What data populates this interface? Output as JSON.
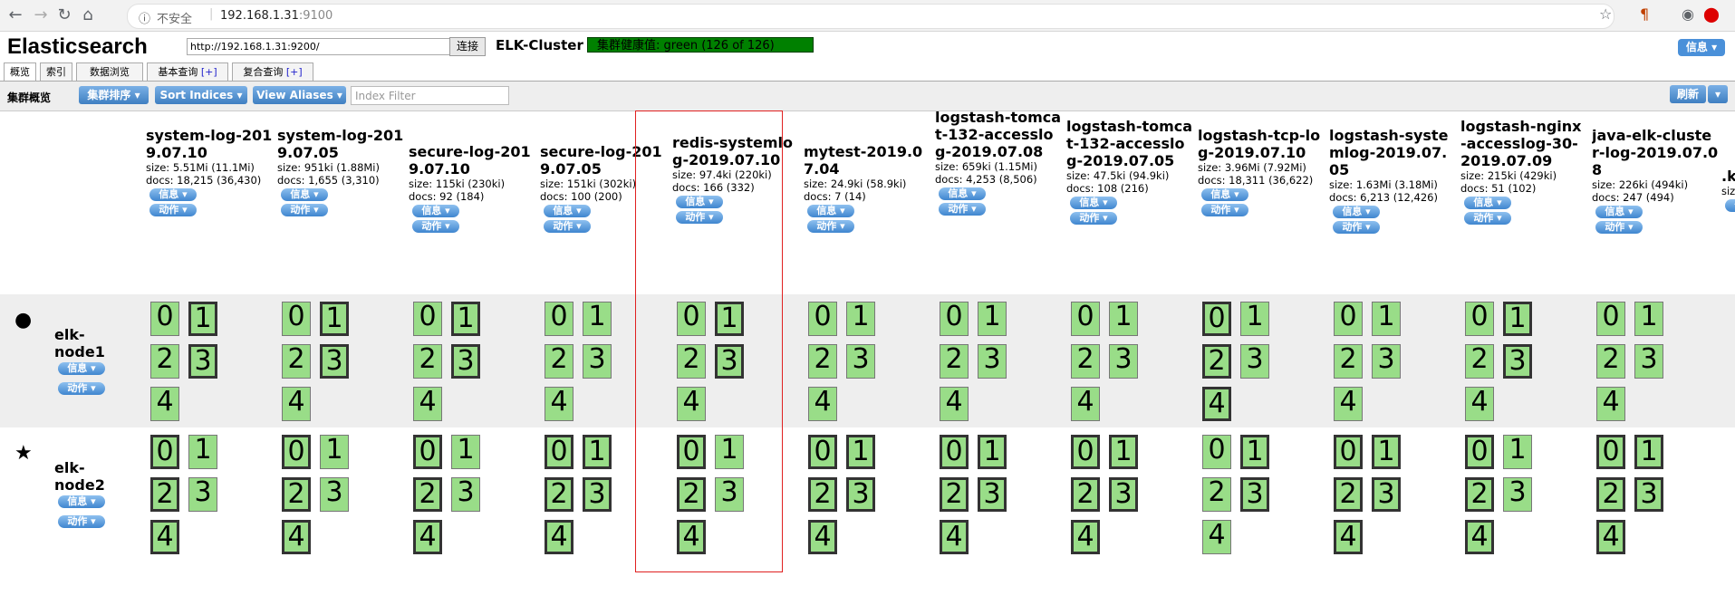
{
  "browser": {
    "security_label": "不安全",
    "url_host": "192.168.1.31",
    "url_port": ":9100"
  },
  "header": {
    "brand": "Elasticsearch",
    "connect_url": "http://192.168.1.31:9200/",
    "connect_button": "连接",
    "cluster_name": "ELK-Cluster",
    "health_text": "集群健康值: green (126 of 126)",
    "health_color": "#008000",
    "info_button": "信息 ▾"
  },
  "tabs": [
    {
      "label": "概览",
      "plus": ""
    },
    {
      "label": "索引",
      "plus": ""
    },
    {
      "label": "数据浏览",
      "plus": ""
    },
    {
      "label": "基本查询",
      "plus": "[+]"
    },
    {
      "label": "复合查询",
      "plus": "[+]"
    }
  ],
  "toolbar": {
    "title": "集群概览",
    "sort_cluster": "集群排序 ▾",
    "sort_indices": "Sort Indices ▾",
    "view_aliases": "View Aliases ▾",
    "filter_placeholder": "Index Filter",
    "refresh": "刷新",
    "refresh_arrow": "▾"
  },
  "pill_info": "信息 ▾",
  "pill_action": "动作 ▾",
  "indices": [
    {
      "name": "system-log-2019.07.10",
      "size": "size: 5.51Mi (11.1Mi)",
      "docs": "docs: 18,215 (36,430)"
    },
    {
      "name": "system-log-2019.07.05",
      "size": "size: 951ki (1.88Mi)",
      "docs": "docs: 1,655 (3,310)"
    },
    {
      "name": "secure-log-2019.07.10",
      "size": "size: 115ki (230ki)",
      "docs": "docs: 92 (184)"
    },
    {
      "name": "secure-log-2019.07.05",
      "size": "size: 151ki (302ki)",
      "docs": "docs: 100 (200)"
    },
    {
      "name": "redis-systemlog-2019.07.10",
      "size": "size: 97.4ki (220ki)",
      "docs": "docs: 166 (332)"
    },
    {
      "name": "mytest-2019.07.04",
      "size": "size: 24.9ki (58.9ki)",
      "docs": "docs: 7 (14)"
    },
    {
      "name": "logstash-tomcat-132-accesslog-2019.07.08",
      "size": "size: 659ki (1.15Mi)",
      "docs": "docs: 4,253 (8,506)"
    },
    {
      "name": "logstash-tomcat-132-accesslog-2019.07.05",
      "size": "size: 47.5ki (94.9ki)",
      "docs": "docs: 108 (216)"
    },
    {
      "name": "logstash-tcp-log-2019.07.10",
      "size": "size: 3.96Mi (7.92Mi)",
      "docs": "docs: 18,311 (36,622)"
    },
    {
      "name": "logstash-systemlog-2019.07.05",
      "size": "size: 1.63Mi (3.18Mi)",
      "docs": "docs: 6,213 (12,426)"
    },
    {
      "name": "logstash-nginx-accesslog-30-2019.07.09",
      "size": "size: 215ki (429ki)",
      "docs": "docs: 51 (102)"
    },
    {
      "name": "java-elk-cluster-log-2019.07.08",
      "size": "size: 226ki (494ki)",
      "docs": "docs: 247 (494)"
    },
    {
      "name": ".k",
      "size": "siz",
      "docs": ""
    }
  ],
  "nodes": [
    {
      "name": "elk-node1",
      "icon": "●",
      "icon_name": "master-node-dot-icon"
    },
    {
      "name": "elk-node2",
      "icon": "★",
      "icon_name": "master-star-icon"
    }
  ],
  "shard_labels": [
    "0",
    "1",
    "2",
    "3",
    "4"
  ],
  "primary_layout": [
    [
      false,
      true,
      false,
      true,
      false
    ],
    [
      false,
      true,
      false,
      true,
      false
    ],
    [
      false,
      true,
      false,
      true,
      false
    ],
    [
      false,
      false,
      false,
      false,
      false
    ],
    [
      false,
      true,
      false,
      true,
      false
    ],
    [
      false,
      false,
      false,
      false,
      false
    ],
    [
      false,
      false,
      false,
      false,
      false
    ],
    [
      false,
      false,
      false,
      false,
      false
    ],
    [
      true,
      false,
      true,
      false,
      true
    ],
    [
      false,
      false,
      false,
      false,
      false
    ],
    [
      false,
      true,
      false,
      true,
      false
    ],
    [
      false,
      false,
      false,
      false,
      false
    ]
  ]
}
